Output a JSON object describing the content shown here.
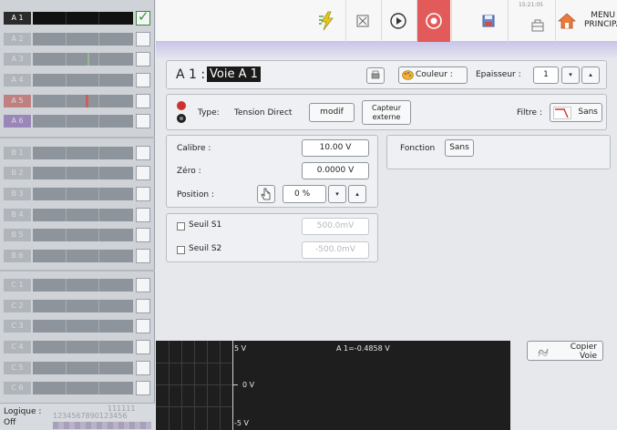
{
  "left_panel": {
    "active_channel": "A 1",
    "channel_tags": [
      "A 1",
      "A 2",
      "A 3",
      "A 4",
      "A 5",
      "A 6",
      "B 1",
      "B 2",
      "B 3",
      "B 4",
      "B 5",
      "B 6",
      "C 1",
      "C 2",
      "C 3",
      "C 4",
      "C 5",
      "C 6"
    ],
    "logic_label": "Logique :",
    "logic_state": "Off",
    "logic_numbers_top": "111111",
    "logic_numbers": "1234567890123456"
  },
  "toolbar": {
    "clock": "15:21:05",
    "menu_line1": "MENU",
    "menu_line2": "PRINCIPAL"
  },
  "channel_header": {
    "id": "A 1 :",
    "name": "Voie A 1",
    "color_label": "Couleur :",
    "thickness_label": "Epaisseur :",
    "thickness_value": "1"
  },
  "type_row": {
    "type_label": "Type:",
    "type_value": "Tension Direct",
    "modif_label": "modif",
    "sensor_line1": "Capteur",
    "sensor_line2": "externe",
    "filter_label": "Filtre :",
    "filter_value": "Sans"
  },
  "settings": {
    "calibre_label": "Calibre :",
    "calibre_value": "10.00 V",
    "zero_label": "Zéro :",
    "zero_value": "0.0000 V",
    "position_label": "Position :",
    "position_value": "0 %",
    "function_label": "Fonction",
    "function_value": "Sans"
  },
  "thresholds": {
    "s1_label": "Seuil S1",
    "s1_value": "500.0mV",
    "s2_label": "Seuil S2",
    "s2_value": "-500.0mV"
  },
  "scope": {
    "top_label": "5 V",
    "mid_label": "0 V",
    "bottom_label": "-5 V",
    "readout": "A 1=-0.4858 V"
  },
  "copy_button": {
    "line1": "Copier",
    "line2": "Voie"
  },
  "colors": {
    "record_button": "#e25a5a",
    "active_check": "#2f9a2f",
    "band_top": "#c9c6e8"
  }
}
